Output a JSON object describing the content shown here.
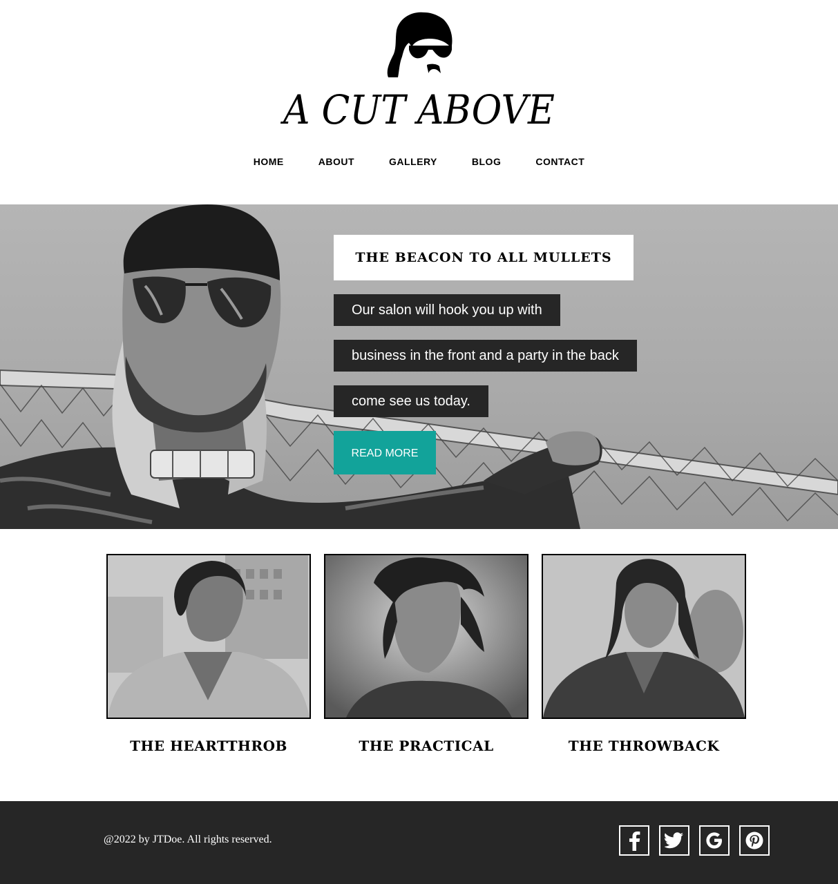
{
  "site": {
    "brand_name": "A CUT ABOVE",
    "logo_icon": "mullet-face-sunglasses-icon"
  },
  "nav": {
    "items": [
      {
        "label": "HOME"
      },
      {
        "label": "ABOUT"
      },
      {
        "label": "GALLERY"
      },
      {
        "label": "BLOG"
      },
      {
        "label": "CONTACT"
      }
    ]
  },
  "hero": {
    "title": "THE BEACON TO ALL MULLETS",
    "lines": [
      "Our salon will hook you up with",
      "business in the front and a party in the back",
      "come see us today."
    ],
    "button_label": "READ MORE",
    "button_color": "#12a39a"
  },
  "styles": [
    {
      "name": "THE HEARTTHROB"
    },
    {
      "name": "THE PRACTICAL"
    },
    {
      "name": "THE THROWBACK"
    }
  ],
  "footer": {
    "copyright": "@2022 by JTDoe. All rights reserved.",
    "social": [
      {
        "icon": "facebook-icon"
      },
      {
        "icon": "twitter-icon"
      },
      {
        "icon": "google-icon"
      },
      {
        "icon": "pinterest-icon"
      }
    ],
    "background": "#262626"
  }
}
